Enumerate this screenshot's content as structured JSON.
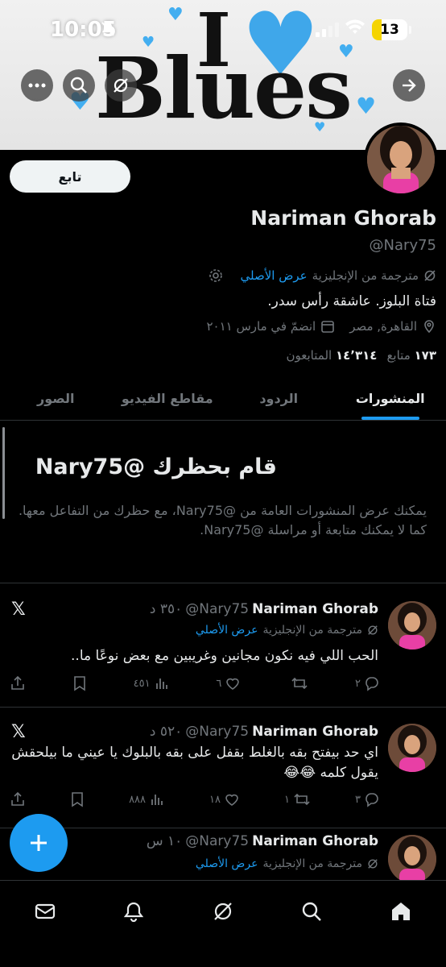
{
  "status_bar": {
    "time": "10:05",
    "battery": "13"
  },
  "profile": {
    "follow_label": "تابع",
    "name": "Nariman Ghorab",
    "handle": "@Nary75",
    "translated_label": "مترجمة من الإنجليزية",
    "show_original": "عرض الأصلي",
    "bio": "فتاة البلوز. عاشقة رأس سدر.",
    "location": "القاهرة, مصر",
    "joined": "انضمّ في مارس ٢٠١١",
    "following_count": "١٧٣",
    "following_label": "متابع",
    "followers_count": "١٤٬٣١٤",
    "followers_label": "المتابعون"
  },
  "tabs": [
    "المنشورات",
    "الردود",
    "مقاطع الفيديو",
    "الصور"
  ],
  "blocked": {
    "title": "قام بحظرك @Nary75",
    "description": "يمكنك عرض المنشورات العامة من @Nary75، مع حظرك من التفاعل معها. كما لا يمكنك متابعة أو مراسلة @Nary75."
  },
  "tweets": [
    {
      "name": "Nariman Ghorab",
      "handle": "@Nary75",
      "time": "٣٥٠ د",
      "translated": "مترجمة من الإنجليزية",
      "show_original": "عرض الأصلي",
      "text": "الحب اللي فيه نكون مجانين وغريبين مع بعض نوعًا ما..",
      "replies": "٢",
      "reposts": "",
      "likes": "٦",
      "views": "٤٥١"
    },
    {
      "name": "Nariman Ghorab",
      "handle": "@Nary75",
      "time": "٥٢٠ د",
      "text": "اي حد بيفتح بقه بالغلط بقفل على بقه بالبلوك يا عيني ما بيلحقش يقول كلمه 😂😂",
      "replies": "٣",
      "reposts": "١",
      "likes": "١٨",
      "views": "٨٨٨"
    },
    {
      "name": "Nariman Ghorab",
      "handle": "@Nary75",
      "time": "١٠ س",
      "translated": "مترجمة من الإنجليزية",
      "show_original": "عرض الأصلي"
    }
  ],
  "banner_text": {
    "top": "I",
    "bottom": "Blues"
  },
  "colors": {
    "accent": "#1d9bf0",
    "muted": "#71767b",
    "background": "#000000",
    "banner_heart": "#43aef0"
  }
}
